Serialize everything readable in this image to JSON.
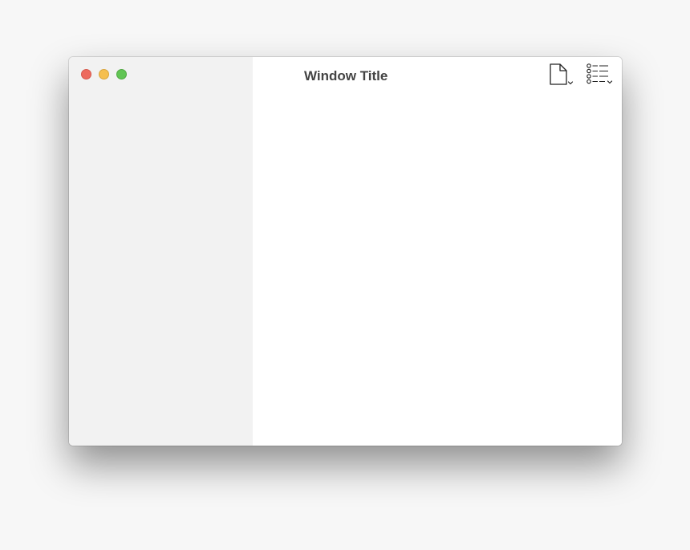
{
  "window": {
    "title": "Window Title"
  },
  "titlebar": {
    "traffic_lights": [
      {
        "name": "close",
        "color": "#ed6a5e"
      },
      {
        "name": "minimize",
        "color": "#f5bf4f"
      },
      {
        "name": "zoom",
        "color": "#61c554"
      }
    ]
  },
  "toolbar": {
    "items": [
      {
        "icon": "new-document-menu-icon"
      },
      {
        "icon": "checklist-menu-icon"
      }
    ]
  }
}
